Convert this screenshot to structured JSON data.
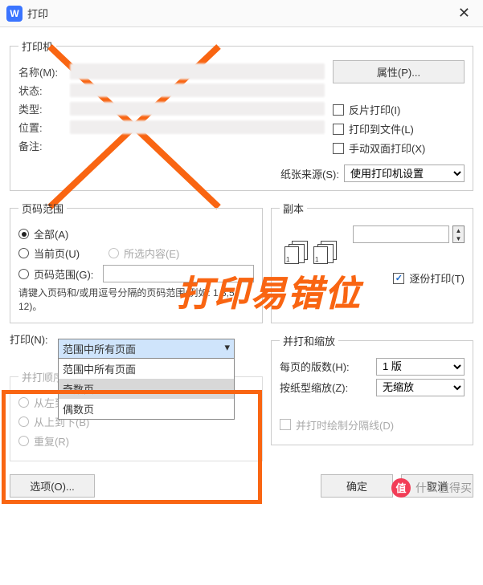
{
  "annotation": {
    "big_text": "打印易错位"
  },
  "titlebar": {
    "app_icon_letter": "W",
    "title": "打印"
  },
  "printer": {
    "legend": "打印机",
    "name_label": "名称(M):",
    "status_label": "状态:",
    "type_label": "类型:",
    "location_label": "位置:",
    "comment_label": "备注:",
    "properties_btn": "属性(P)...",
    "mirror_print": "反片打印(I)",
    "print_to_file": "打印到文件(L)",
    "manual_duplex": "手动双面打印(X)",
    "paper_source_label": "纸张来源(S):",
    "paper_source_value": "使用打印机设置"
  },
  "range": {
    "legend": "页码范围",
    "all": "全部(A)",
    "current": "当前页(U)",
    "selection": "所选内容(E)",
    "pages": "页码范围(G):",
    "hint": "请键入页码和/或用逗号分隔的页码范围(例如: 1,3,5-12)。"
  },
  "copies": {
    "legend": "副本",
    "count_value": "",
    "collate": "逐份打印(T)"
  },
  "print_what": {
    "label": "打印(N):",
    "selected": "范围中所有页面",
    "options": [
      "范围中所有页面",
      "奇数页",
      "偶数页"
    ]
  },
  "order": {
    "label": "并打顺序",
    "lr": "从左到",
    "tb": "从上到下(B)",
    "repeat": "重复(R)"
  },
  "zoom": {
    "legend": "并打和缩放",
    "pages_per_sheet_label": "每页的版数(H):",
    "pages_per_sheet_value": "1 版",
    "scale_label": "按纸型缩放(Z):",
    "scale_value": "无缩放",
    "draw_separator": "并打时绘制分隔线(D)"
  },
  "footer": {
    "options": "选项(O)...",
    "ok": "确定",
    "cancel": "取消"
  },
  "watermark": {
    "badge": "值",
    "text": "什么值得买"
  }
}
